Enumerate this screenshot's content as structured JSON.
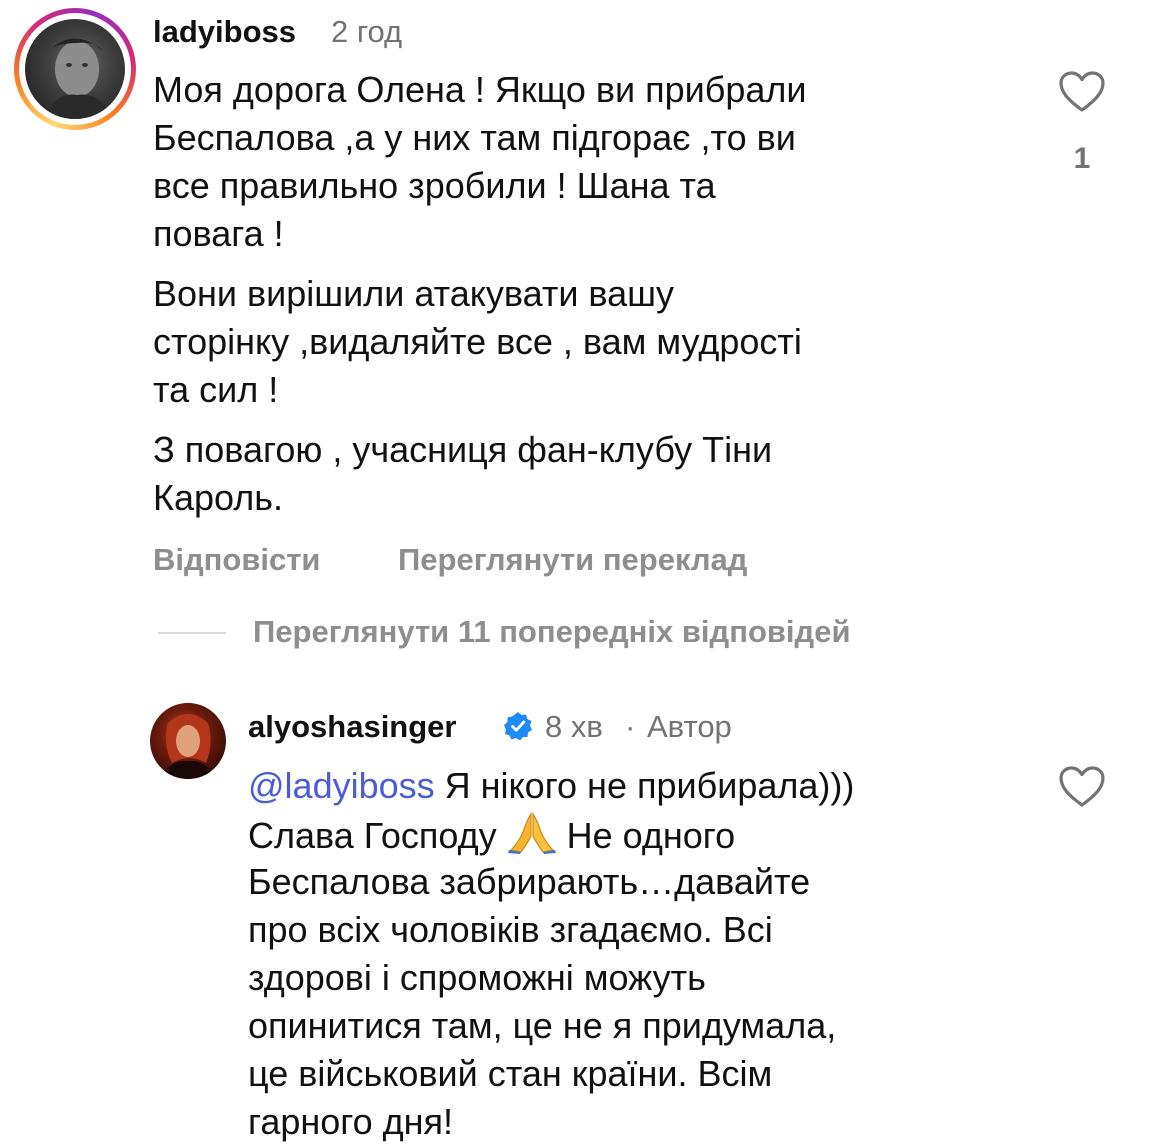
{
  "comment": {
    "username": "ladyiboss",
    "time": "2 год",
    "paragraphs": [
      "Моя дорога Олена ! Якщо ви прибрали\nБеспалова ,а у них там підгорає ,то ви\nвсе правильно зробили ! Шана та\nповага !",
      "Вони вирішили атакувати вашу\nсторінку ,видаляйте все , вам мудрості\nта сил !",
      "З повагою , учасниця фан-клубу Тіни\nКароль."
    ],
    "like_count": "1",
    "reply_label": "Відповісти",
    "translate_label": "Переглянути переклад"
  },
  "view_previous_replies": "Переглянути 11 попередніх відповідей",
  "reply": {
    "username": "alyoshasinger",
    "time": "8 хв",
    "separator": "·",
    "author_label": "Автор",
    "mention": "@ladyiboss",
    "line1_rest": " Я нікого не прибирала)))",
    "line2_start": "Слава Господу ",
    "line2_end": " Не одного",
    "rest_text": "Беспалова забрирають…давайте\nпро всіх чоловіків згадаємо. Всі\nздорові і спроможні можуть\nопинитися там, це не я придумала,\nце військовий стан країни. Всім\nгарного дня!"
  },
  "icons": {
    "like": "heart-outline-icon",
    "verified": "verified-badge-icon",
    "emoji": "folded-hands-emoji"
  },
  "colors": {
    "text": "#111111",
    "secondary": "#737373",
    "action": "#8e8e8e",
    "mention": "#4a5dd6",
    "verified": "#1d8cf7"
  }
}
